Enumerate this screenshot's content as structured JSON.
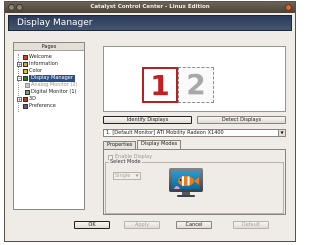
{
  "window": {
    "title": "Catalyst Control Center - Linux Edition"
  },
  "header": {
    "title": "Display Manager"
  },
  "pages": {
    "heading": "Pages",
    "items": [
      {
        "label": "Welcome",
        "expander": "",
        "icon_color": "#c84a20"
      },
      {
        "label": "Information",
        "expander": "+",
        "icon_color": "#d6a832"
      },
      {
        "label": "Color",
        "expander": "",
        "icon_color": "#e0bb3a"
      },
      {
        "label": "Display Manager",
        "expander": "",
        "icon_color": "#2a7a2a"
      },
      {
        "label": "Analog Monitor (2)",
        "expander": "",
        "icon_color": "#9a9690"
      },
      {
        "label": "Digital Monitor (1)",
        "expander": "",
        "icon_color": "#6aa96a"
      },
      {
        "label": "3D",
        "expander": "+",
        "icon_color": "#b23a2a"
      },
      {
        "label": "Preference",
        "expander": "",
        "icon_color": "#7a4a9a"
      }
    ]
  },
  "monitors": {
    "primary": "1",
    "secondary": "2"
  },
  "buttons": {
    "identify": "Identify Displays",
    "detect": "Detect Displays",
    "ok": "OK",
    "apply": "Apply",
    "cancel": "Cancel",
    "default": "Default"
  },
  "display_select": {
    "value": "1.  [Default Monitor] ATI Mobility Radeon X1400"
  },
  "tabs": [
    {
      "label": "Properties"
    },
    {
      "label": "Display Modes"
    }
  ],
  "display_modes": {
    "enable_label": "Enable Display",
    "group_label": "Select Mode",
    "mode_value": "Single"
  },
  "colors": {
    "accent": "#2c4f8a",
    "header_bg": "#2c3a5a"
  }
}
